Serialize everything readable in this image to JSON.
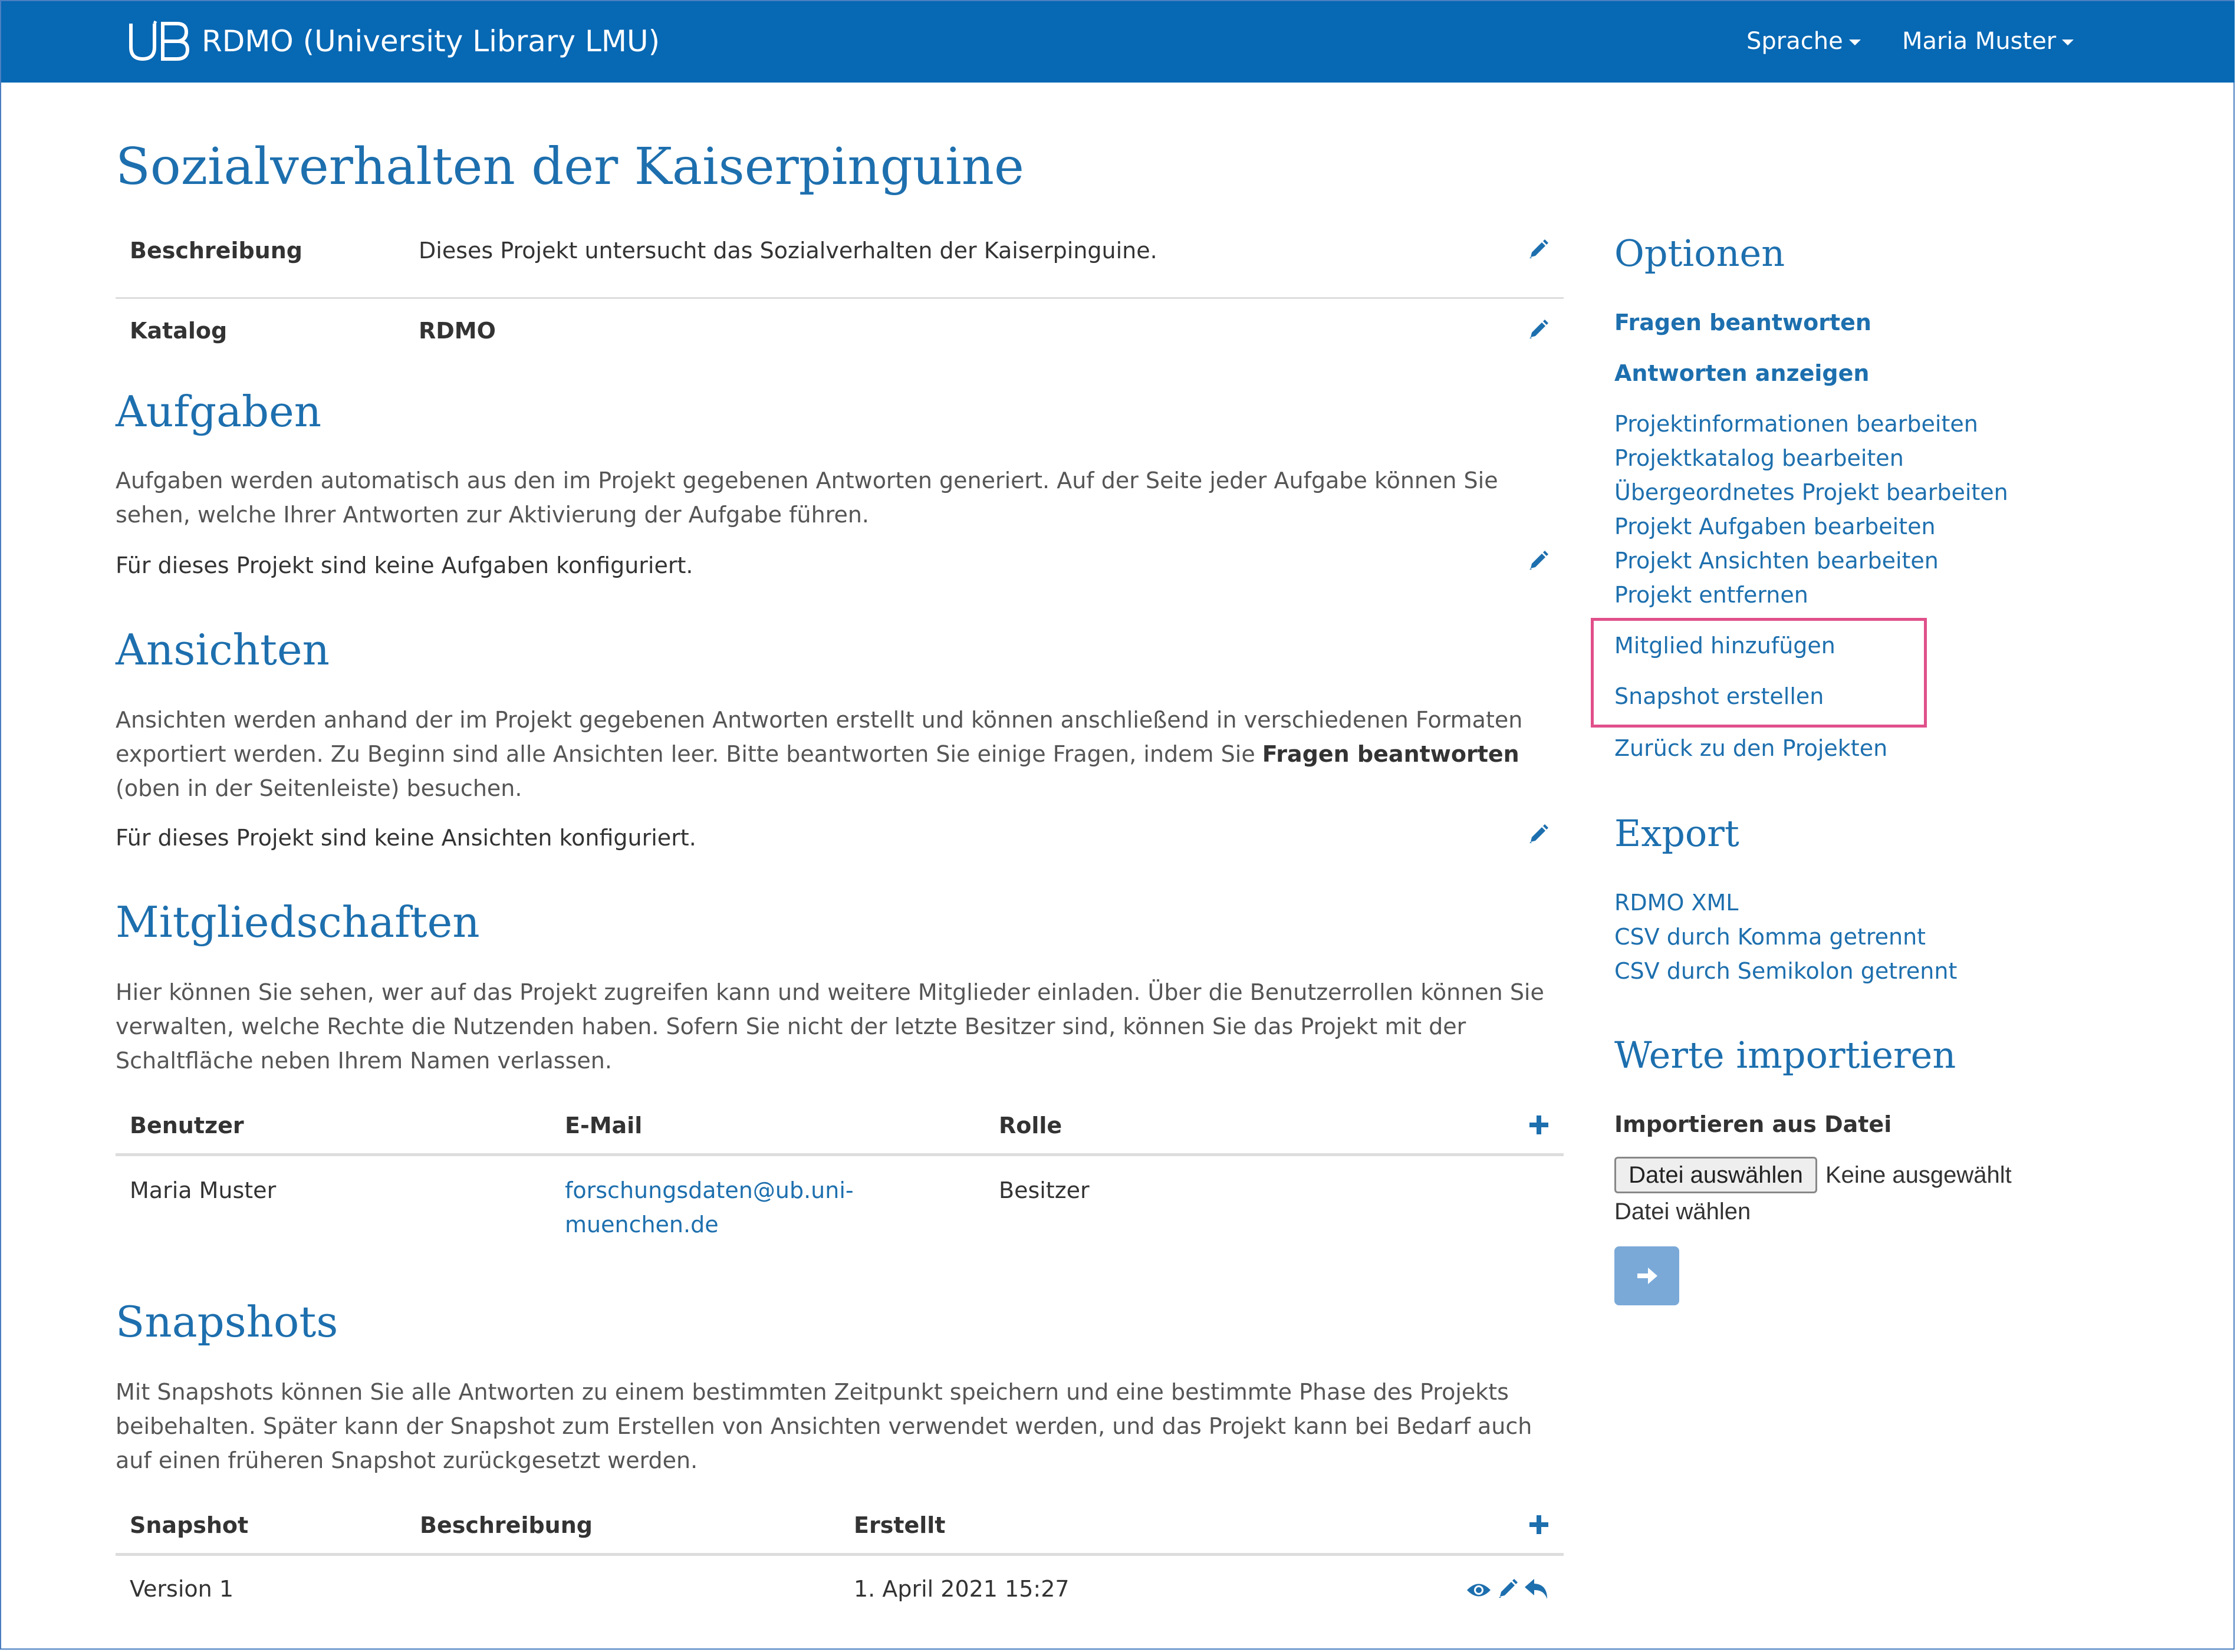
{
  "navbar": {
    "brand": "RDMO (University Library LMU)",
    "language_menu": "Sprache",
    "user_menu": "Maria Muster"
  },
  "project": {
    "title": "Sozialverhalten der Kaiserpinguine",
    "description_label": "Beschreibung",
    "description_value": "Dieses Projekt untersucht das Sozialverhalten der Kaiserpinguine.",
    "catalog_label": "Katalog",
    "catalog_value": "RDMO"
  },
  "tasks": {
    "heading": "Aufgaben",
    "text": "Aufgaben werden automatisch aus den im Projekt gegebenen Antworten generiert. Auf der Seite jeder Aufgabe können Sie sehen, welche Ihrer Antworten zur Aktivierung der Aufgabe führen.",
    "empty": "Für dieses Projekt sind keine Aufgaben konfiguriert."
  },
  "views": {
    "heading": "Ansichten",
    "text_before": "Ansichten werden anhand der im Projekt gegebenen Antworten erstellt und können anschließend in verschiedenen Formaten exportiert werden. Zu Beginn sind alle Ansichten leer. Bitte beantworten Sie einige Fragen, indem Sie ",
    "text_bold": "Fragen beantworten",
    "text_after": " (oben in der Seitenleiste) besuchen.",
    "empty": "Für dieses Projekt sind keine Ansichten konfiguriert."
  },
  "memberships": {
    "heading": "Mitgliedschaften",
    "text": "Hier können Sie sehen, wer auf das Projekt zugreifen kann und weitere Mitglieder einladen. Über die Benutzerrollen können Sie verwalten, welche Rechte die Nutzenden haben. Sofern Sie nicht der letzte Besitzer sind, können Sie das Projekt mit der Schaltfläche neben Ihrem Namen verlassen.",
    "columns": [
      "Benutzer",
      "E-Mail",
      "Rolle"
    ],
    "rows": [
      {
        "user": "Maria Muster",
        "email_line1": "forschungsdaten@ub.uni-",
        "email_line2": "muenchen.de",
        "role": "Besitzer"
      }
    ]
  },
  "snapshots": {
    "heading": "Snapshots",
    "text": "Mit Snapshots können Sie alle Antworten zu einem bestimmten Zeitpunkt speichern und eine bestimmte Phase des Projekts beibehalten. Später kann der Snapshot zum Erstellen von Ansichten verwendet werden, und das Projekt kann bei Bedarf auch auf einen früheren Snapshot zurückgesetzt werden.",
    "columns": [
      "Snapshot",
      "Beschreibung",
      "Erstellt"
    ],
    "rows": [
      {
        "name": "Version 1",
        "description": "",
        "created": "1. April 2021 15:27"
      }
    ]
  },
  "sidebar": {
    "options_heading": "Optionen",
    "answer_questions": "Fragen beantworten",
    "show_answers": "Antworten anzeigen",
    "edit_links": [
      "Projektinformationen bearbeiten",
      "Projektkatalog bearbeiten",
      "Übergeordnetes Projekt bearbeiten",
      "Projekt Aufgaben bearbeiten",
      "Projekt Ansichten bearbeiten",
      "Projekt entfernen"
    ],
    "add_member": "Mitglied hinzufügen",
    "create_snapshot": "Snapshot erstellen",
    "back_to_projects": "Zurück zu den Projekten",
    "export_heading": "Export",
    "export_links": [
      "RDMO XML",
      "CSV durch Komma getrennt",
      "CSV durch Semikolon getrennt"
    ],
    "import_heading": "Werte importieren",
    "import_label": "Importieren aus Datei",
    "file_button": "Datei auswählen",
    "file_status_line1": "Keine ausgewählt",
    "file_status_line2": "Datei wählen"
  },
  "colors": {
    "navbar": "#0768b4",
    "link": "#1d6fae",
    "highlight": "#e0508a",
    "submit_button": "#7aa9d8"
  },
  "icons": {
    "edit": "pencil-icon",
    "add": "plus-icon",
    "view": "eye-icon",
    "rollback": "reply-icon"
  }
}
